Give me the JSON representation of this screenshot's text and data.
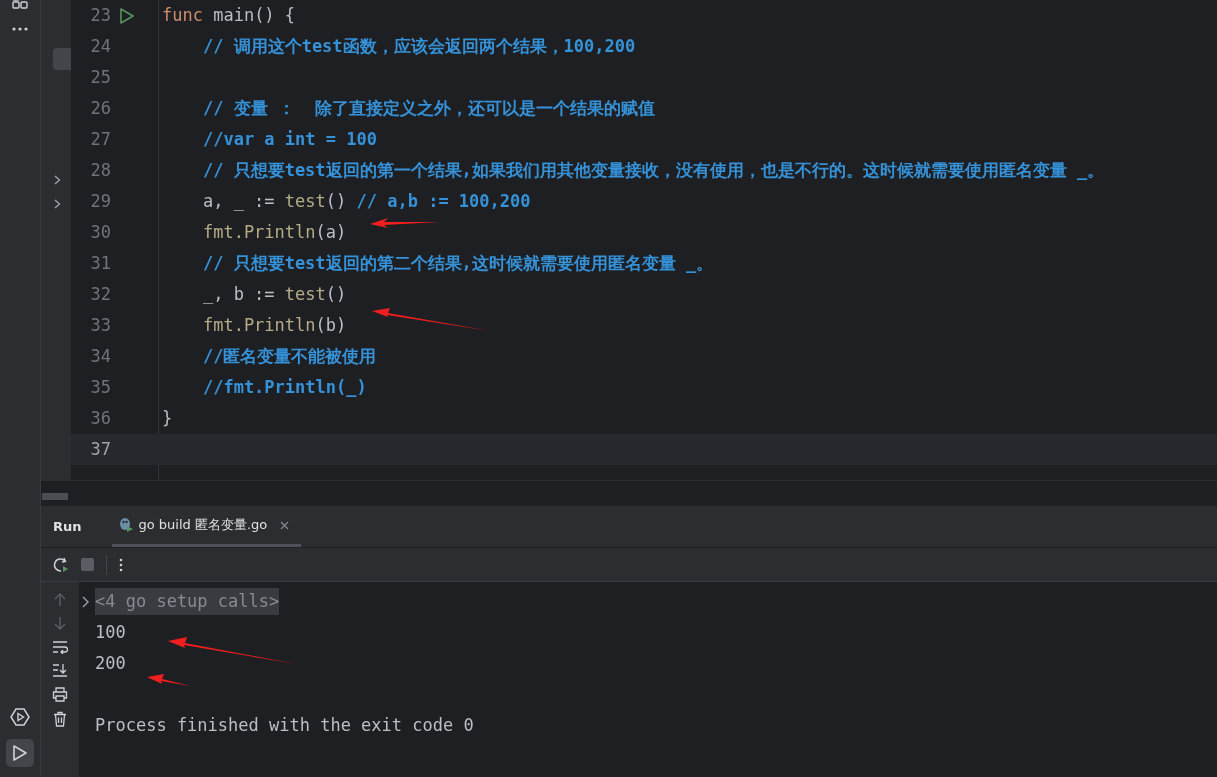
{
  "editor": {
    "lines": [
      {
        "number": "23",
        "run_marker": true,
        "tokens": [
          {
            "kind": "keyword",
            "text": "func"
          },
          {
            "kind": "plain",
            "text": " main() {"
          }
        ]
      },
      {
        "number": "24",
        "tokens": [
          {
            "kind": "comment",
            "text": "    // 调用这个test函数，应该会返回两个结果，100,200"
          }
        ]
      },
      {
        "number": "25"
      },
      {
        "number": "26",
        "tokens": [
          {
            "kind": "comment",
            "text": "    // 变量 ：  除了直接定义之外，还可以是一个结果的赋值"
          }
        ]
      },
      {
        "number": "27",
        "tokens": [
          {
            "kind": "comment",
            "text": "    //var a int = 100"
          }
        ]
      },
      {
        "number": "28",
        "tokens": [
          {
            "kind": "comment",
            "text": "    // 只想要test返回的第一个结果,如果我们用其他变量接收，没有使用，也是不行的。这时候就需要使用匿名变量 _。"
          }
        ]
      },
      {
        "number": "29",
        "tokens": [
          {
            "kind": "plain",
            "text": "    a, _ := "
          },
          {
            "kind": "call",
            "text": "test"
          },
          {
            "kind": "plain",
            "text": "() "
          },
          {
            "kind": "comment",
            "text": "// a,b := 100,200"
          }
        ]
      },
      {
        "number": "30",
        "tokens": [
          {
            "kind": "call",
            "text": "    fmt.Println"
          },
          {
            "kind": "plain",
            "text": "(a)"
          }
        ]
      },
      {
        "number": "31",
        "tokens": [
          {
            "kind": "comment",
            "text": "    // 只想要test返回的第二个结果,这时候就需要使用匿名变量 _。"
          }
        ]
      },
      {
        "number": "32",
        "tokens": [
          {
            "kind": "plain",
            "text": "    _, b := "
          },
          {
            "kind": "call",
            "text": "test"
          },
          {
            "kind": "plain",
            "text": "()"
          }
        ]
      },
      {
        "number": "33",
        "tokens": [
          {
            "kind": "call",
            "text": "    fmt.Println"
          },
          {
            "kind": "plain",
            "text": "(b)"
          }
        ]
      },
      {
        "number": "34",
        "tokens": [
          {
            "kind": "comment",
            "text": "    //匿名变量不能被使用"
          }
        ]
      },
      {
        "number": "35",
        "tokens": [
          {
            "kind": "comment",
            "text": "    //fmt.Println(_)"
          }
        ]
      },
      {
        "number": "36",
        "tokens": [
          {
            "kind": "plain",
            "text": "}"
          }
        ]
      },
      {
        "number": "37",
        "current": true
      }
    ]
  },
  "run_panel": {
    "title": "Run",
    "tabs": [
      {
        "label": "go build 匿名变量.go",
        "selected": true
      }
    ],
    "console": [
      {
        "kind": "fold",
        "text": "<4 go setup calls>"
      },
      {
        "kind": "output",
        "text": "100"
      },
      {
        "kind": "output",
        "text": "200"
      },
      {
        "kind": "blank"
      },
      {
        "kind": "output",
        "text": "Process finished with the exit code 0"
      }
    ]
  }
}
